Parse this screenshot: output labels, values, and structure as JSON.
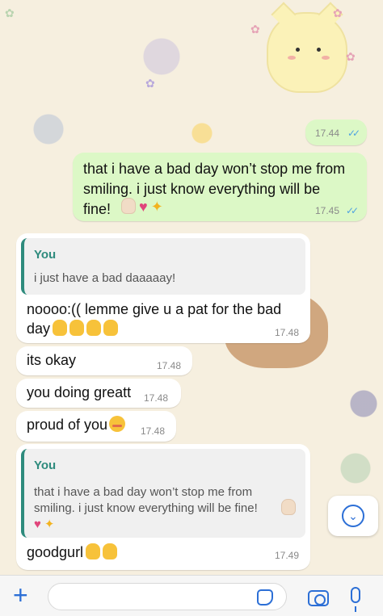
{
  "messages": {
    "m0": {
      "time": "17.44",
      "ticks": "✓✓"
    },
    "m1": {
      "text": "that i have a bad day won’t stop me from\nsmiling. i just know everything will be\nfine!",
      "time": "17.45",
      "ticks": "✓✓"
    },
    "m2": {
      "quote_author": "You",
      "quote_text": "i just have a bad daaaaay!",
      "text_line1": "noooo:(( lemme give u a pat for the bad",
      "text_line2": "day",
      "time": "17.48"
    },
    "m3": {
      "text": "its okay",
      "time": "17.48"
    },
    "m4": {
      "text": "you doing greatt",
      "time": "17.48"
    },
    "m5": {
      "text": "proud of you",
      "time": "17.48"
    },
    "m6": {
      "quote_author": "You",
      "quote_text": "that i have a bad day won’t stop me from\nsmiling. i just know everything will be fine!",
      "text": "goodgurl",
      "time": "17.49"
    }
  },
  "icons": {
    "attach": "plus-icon",
    "sticker": "sticker-icon",
    "camera": "camera-icon",
    "mic": "microphone-icon",
    "scroll": "chevron-down-icon"
  },
  "colors": {
    "accent": "#2c6fd6",
    "outgoing_bubble": "#dcf8c6",
    "incoming_bubble": "#ffffff",
    "quote_bar": "#2e8b7d",
    "read_ticks": "#4fa3e0",
    "wallpaper": "#f6efdf"
  },
  "composer": {
    "placeholder": ""
  }
}
